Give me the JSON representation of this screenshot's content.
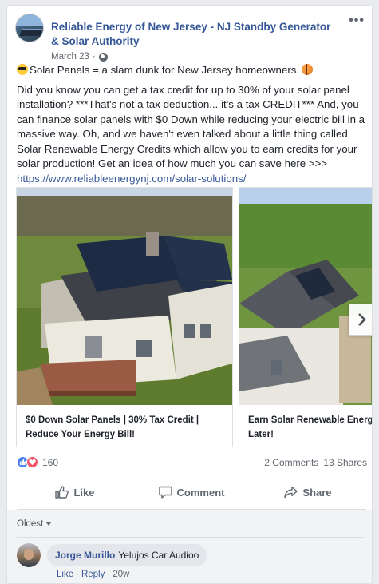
{
  "post": {
    "page_name": "Reliable Energy of New Jersey - NJ Standby Generator & Solar Authority",
    "date": "March 23",
    "date_separator": "·",
    "more_label": "•••",
    "headline": "Solar Panels = a slam dunk for New Jersey homeowners.",
    "body": "Did you know you can get a tax credit for up to 30% of your solar panel installation? ***That's not a tax deduction... it's a tax CREDIT*** And, you can finance solar panels with $0 Down while reducing your electric bill in a massive way. Oh, and we haven't even talked about a little thing called Solar Renewable Energy Credits which allow you to earn credits for your solar production! Get an idea of how much you can save here >>>",
    "link": "https://www.reliableenergynj.com/solar-solutions/"
  },
  "carousel": {
    "slides": [
      {
        "caption": "$0 Down Solar Panels | 30% Tax Credit | Reduce Your Energy Bill!"
      },
      {
        "caption": "Earn Solar Renewable Energy Credits Now... Pay Later!"
      }
    ],
    "slide2_caption_line1": "Earn Solar Renewable Energy",
    "slide2_caption_line2": "Later!"
  },
  "stats": {
    "reaction_count": "160",
    "comments": "2 Comments",
    "shares": "13 Shares"
  },
  "actions": {
    "like": "Like",
    "comment": "Comment",
    "share": "Share"
  },
  "comments": {
    "sort_label": "Oldest",
    "items": [
      {
        "author": "Jorge Murillo",
        "text": "Yelujos Car Audioo",
        "like": "Like",
        "reply": "Reply",
        "time": "20w",
        "sep": "·"
      }
    ]
  },
  "colors": {
    "link": "#365899",
    "like_blue": "#4b80f2",
    "love_red": "#f25268",
    "background": "#e9ebee"
  },
  "icons": [
    "globe-icon",
    "cool-face-emoji",
    "basketball-emoji",
    "chevron-right-icon",
    "like-icon",
    "comment-icon",
    "share-icon",
    "caret-down-icon"
  ]
}
